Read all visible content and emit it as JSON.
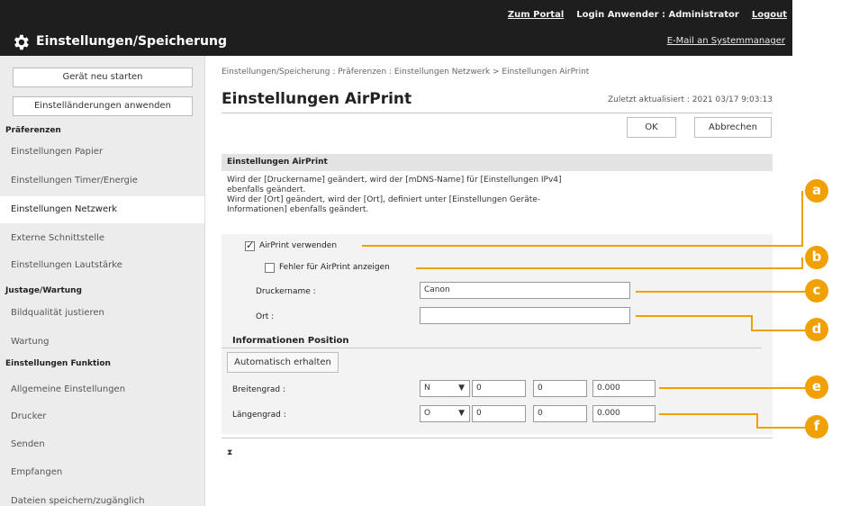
{
  "topbar": {
    "portal_link": "Zum Portal",
    "login_label": "Login Anwender : ",
    "user_name": "Administrator",
    "logout_link": "Logout",
    "mail_link": "E-Mail an Systemmanager",
    "title": "Einstellungen/Speicherung"
  },
  "sidebar": {
    "restart_button": "Gerät neu starten",
    "apply_button": "Einstelländerungen anwenden",
    "groups": {
      "preferences": "Präferenzen",
      "adjust": "Justage/Wartung",
      "function": "Einstellungen Funktion"
    },
    "items": [
      "Einstellungen Papier",
      "Einstellungen Timer/Energie",
      "Einstellungen Netzwerk",
      "Externe Schnittstelle",
      "Einstellungen Lautstärke",
      "Bildqualität justieren",
      "Wartung",
      "Allgemeine Einstellungen",
      "Drucker",
      "Senden",
      "Empfangen",
      "Dateien speichern/zugänglich"
    ]
  },
  "main": {
    "breadcrumb": "Einstellungen/Speicherung : Präferenzen : Einstellungen Netzwerk > Einstellungen AirPrint",
    "title": "Einstellungen AirPrint",
    "updated": "Zuletzt aktualisiert : 2021 03/17 9:03:13",
    "ok_button": "OK",
    "cancel_button": "Abbrechen",
    "section_title": "Einstellungen AirPrint",
    "desc_line1": "Wird der [Druckername] geändert, wird der [mDNS-Name] für [Einstellungen IPv4]",
    "desc_line2": "ebenfalls geändert.",
    "desc_line3": "Wird der [Ort] geändert, wird der [Ort], definiert unter [Einstellungen Geräte-",
    "desc_line4": "Informationen] ebenfalls geändert.",
    "use_airprint": "AirPrint verwenden",
    "show_errors": "Fehler für AirPrint anzeigen",
    "printer_name_label": "Druckername :",
    "printer_name_value": "Canon",
    "location_label": "Ort :",
    "location_value": "",
    "position_head": "Informationen Position",
    "auto_button": "Automatisch erhalten",
    "latitude_label": "Breitengrad :",
    "latitude_dir": "N",
    "latitude_deg": "0",
    "latitude_min": "0",
    "latitude_sec": "0.000",
    "longitude_label": "Längengrad :",
    "longitude_dir": "O",
    "longitude_deg": "0",
    "longitude_min": "0",
    "longitude_sec": "0.000",
    "scroll_top": "⧗"
  },
  "callouts": [
    "a",
    "b",
    "c",
    "d",
    "e",
    "f"
  ],
  "colors": {
    "callout": "#f0a000",
    "topbar": "#1e1e1e",
    "sidebar": "#ececec"
  }
}
